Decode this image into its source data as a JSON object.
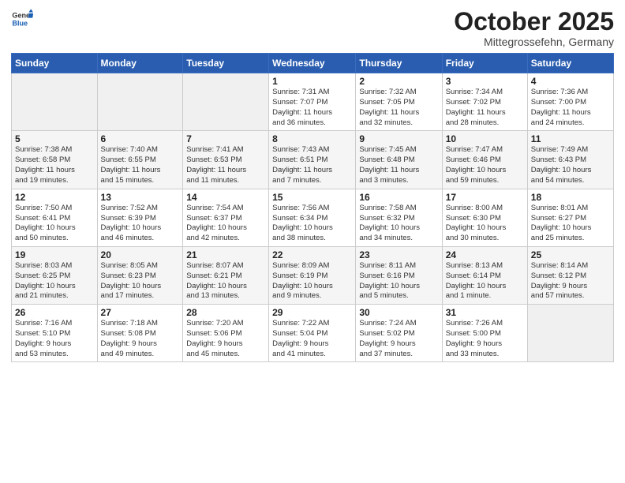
{
  "logo": {
    "general": "General",
    "blue": "Blue"
  },
  "header": {
    "month": "October 2025",
    "location": "Mittegrossefehn, Germany"
  },
  "weekdays": [
    "Sunday",
    "Monday",
    "Tuesday",
    "Wednesday",
    "Thursday",
    "Friday",
    "Saturday"
  ],
  "weeks": [
    [
      {
        "day": "",
        "info": ""
      },
      {
        "day": "",
        "info": ""
      },
      {
        "day": "",
        "info": ""
      },
      {
        "day": "1",
        "info": "Sunrise: 7:31 AM\nSunset: 7:07 PM\nDaylight: 11 hours\nand 36 minutes."
      },
      {
        "day": "2",
        "info": "Sunrise: 7:32 AM\nSunset: 7:05 PM\nDaylight: 11 hours\nand 32 minutes."
      },
      {
        "day": "3",
        "info": "Sunrise: 7:34 AM\nSunset: 7:02 PM\nDaylight: 11 hours\nand 28 minutes."
      },
      {
        "day": "4",
        "info": "Sunrise: 7:36 AM\nSunset: 7:00 PM\nDaylight: 11 hours\nand 24 minutes."
      }
    ],
    [
      {
        "day": "5",
        "info": "Sunrise: 7:38 AM\nSunset: 6:58 PM\nDaylight: 11 hours\nand 19 minutes."
      },
      {
        "day": "6",
        "info": "Sunrise: 7:40 AM\nSunset: 6:55 PM\nDaylight: 11 hours\nand 15 minutes."
      },
      {
        "day": "7",
        "info": "Sunrise: 7:41 AM\nSunset: 6:53 PM\nDaylight: 11 hours\nand 11 minutes."
      },
      {
        "day": "8",
        "info": "Sunrise: 7:43 AM\nSunset: 6:51 PM\nDaylight: 11 hours\nand 7 minutes."
      },
      {
        "day": "9",
        "info": "Sunrise: 7:45 AM\nSunset: 6:48 PM\nDaylight: 11 hours\nand 3 minutes."
      },
      {
        "day": "10",
        "info": "Sunrise: 7:47 AM\nSunset: 6:46 PM\nDaylight: 10 hours\nand 59 minutes."
      },
      {
        "day": "11",
        "info": "Sunrise: 7:49 AM\nSunset: 6:43 PM\nDaylight: 10 hours\nand 54 minutes."
      }
    ],
    [
      {
        "day": "12",
        "info": "Sunrise: 7:50 AM\nSunset: 6:41 PM\nDaylight: 10 hours\nand 50 minutes."
      },
      {
        "day": "13",
        "info": "Sunrise: 7:52 AM\nSunset: 6:39 PM\nDaylight: 10 hours\nand 46 minutes."
      },
      {
        "day": "14",
        "info": "Sunrise: 7:54 AM\nSunset: 6:37 PM\nDaylight: 10 hours\nand 42 minutes."
      },
      {
        "day": "15",
        "info": "Sunrise: 7:56 AM\nSunset: 6:34 PM\nDaylight: 10 hours\nand 38 minutes."
      },
      {
        "day": "16",
        "info": "Sunrise: 7:58 AM\nSunset: 6:32 PM\nDaylight: 10 hours\nand 34 minutes."
      },
      {
        "day": "17",
        "info": "Sunrise: 8:00 AM\nSunset: 6:30 PM\nDaylight: 10 hours\nand 30 minutes."
      },
      {
        "day": "18",
        "info": "Sunrise: 8:01 AM\nSunset: 6:27 PM\nDaylight: 10 hours\nand 25 minutes."
      }
    ],
    [
      {
        "day": "19",
        "info": "Sunrise: 8:03 AM\nSunset: 6:25 PM\nDaylight: 10 hours\nand 21 minutes."
      },
      {
        "day": "20",
        "info": "Sunrise: 8:05 AM\nSunset: 6:23 PM\nDaylight: 10 hours\nand 17 minutes."
      },
      {
        "day": "21",
        "info": "Sunrise: 8:07 AM\nSunset: 6:21 PM\nDaylight: 10 hours\nand 13 minutes."
      },
      {
        "day": "22",
        "info": "Sunrise: 8:09 AM\nSunset: 6:19 PM\nDaylight: 10 hours\nand 9 minutes."
      },
      {
        "day": "23",
        "info": "Sunrise: 8:11 AM\nSunset: 6:16 PM\nDaylight: 10 hours\nand 5 minutes."
      },
      {
        "day": "24",
        "info": "Sunrise: 8:13 AM\nSunset: 6:14 PM\nDaylight: 10 hours\nand 1 minute."
      },
      {
        "day": "25",
        "info": "Sunrise: 8:14 AM\nSunset: 6:12 PM\nDaylight: 9 hours\nand 57 minutes."
      }
    ],
    [
      {
        "day": "26",
        "info": "Sunrise: 7:16 AM\nSunset: 5:10 PM\nDaylight: 9 hours\nand 53 minutes."
      },
      {
        "day": "27",
        "info": "Sunrise: 7:18 AM\nSunset: 5:08 PM\nDaylight: 9 hours\nand 49 minutes."
      },
      {
        "day": "28",
        "info": "Sunrise: 7:20 AM\nSunset: 5:06 PM\nDaylight: 9 hours\nand 45 minutes."
      },
      {
        "day": "29",
        "info": "Sunrise: 7:22 AM\nSunset: 5:04 PM\nDaylight: 9 hours\nand 41 minutes."
      },
      {
        "day": "30",
        "info": "Sunrise: 7:24 AM\nSunset: 5:02 PM\nDaylight: 9 hours\nand 37 minutes."
      },
      {
        "day": "31",
        "info": "Sunrise: 7:26 AM\nSunset: 5:00 PM\nDaylight: 9 hours\nand 33 minutes."
      },
      {
        "day": "",
        "info": ""
      }
    ]
  ]
}
